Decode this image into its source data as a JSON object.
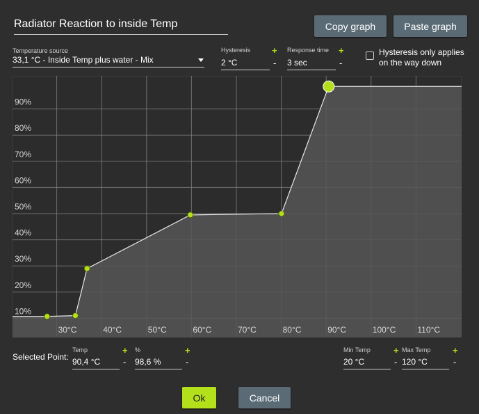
{
  "dialog": {
    "title": "Radiator Reaction to inside Temp",
    "copy_label": "Copy graph",
    "paste_label": "Paste graph"
  },
  "settings": {
    "source_label": "Temperature source",
    "source_value": "33,1 °C - Inside Temp plus water  - Mix",
    "hysteresis_label": "Hysteresis",
    "hysteresis_value": "2 °C",
    "response_label": "Response time",
    "response_value": "3 sec",
    "checkbox_text": "Hysteresis only applies on the way down",
    "checkbox_checked": false
  },
  "selected": {
    "label": "Selected Point:",
    "temp_label": "Temp",
    "temp_value": "90,4 °C",
    "pct_label": "%",
    "pct_value": "98,6 %",
    "min_label": "Min Temp",
    "min_value": "20 °C",
    "max_label": "Max Temp",
    "max_value": "120 °C"
  },
  "footer": {
    "ok_label": "Ok",
    "cancel_label": "Cancel"
  },
  "symbols": {
    "plus": "+",
    "minus": "-"
  },
  "colors": {
    "accent": "#b3e01b",
    "button": "#5b6b76",
    "background": "#2e2e2e",
    "chart_fill": "#565656",
    "chart_bg": "#2c2c2c"
  },
  "chart_data": {
    "type": "area",
    "xlim": [
      20,
      120
    ],
    "ylim": [
      0,
      100
    ],
    "x_ticks": [
      30,
      40,
      50,
      60,
      70,
      80,
      90,
      100,
      110
    ],
    "x_tick_labels": [
      "30°C",
      "40°C",
      "50°C",
      "60°C",
      "70°C",
      "80°C",
      "90°C",
      "100°C",
      "110°C"
    ],
    "y_ticks": [
      10,
      20,
      30,
      40,
      50,
      60,
      70,
      80,
      90
    ],
    "y_tick_labels": [
      "10%",
      "20%",
      "30%",
      "40%",
      "50%",
      "60%",
      "70%",
      "80%",
      "90%"
    ],
    "grid": true,
    "points": [
      {
        "x": 27.7,
        "y": 10.7
      },
      {
        "x": 34.0,
        "y": 11.0
      },
      {
        "x": 36.6,
        "y": 29.0
      },
      {
        "x": 59.6,
        "y": 49.5
      },
      {
        "x": 79.9,
        "y": 50.0
      },
      {
        "x": 90.4,
        "y": 98.6
      }
    ],
    "extends_to": [
      {
        "x": 20,
        "y": 10.7
      },
      {
        "x": 120,
        "y": 98.6
      }
    ],
    "selected_index": 5
  }
}
